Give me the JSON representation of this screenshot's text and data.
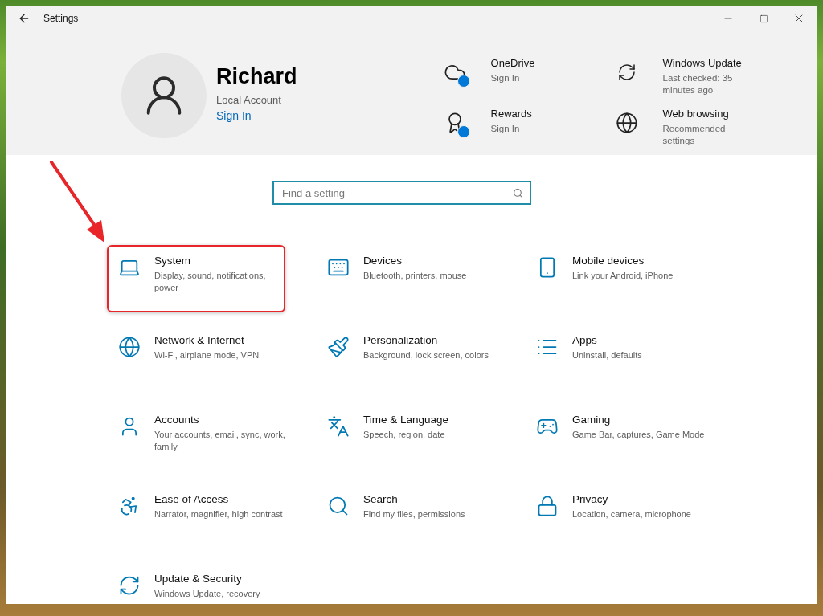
{
  "window": {
    "title": "Settings"
  },
  "account": {
    "name": "Richard",
    "type": "Local Account",
    "link": "Sign In"
  },
  "services": [
    {
      "kind": "cloud",
      "title": "OneDrive",
      "subtitle": "Sign In"
    },
    {
      "kind": "update",
      "title": "Windows Update",
      "subtitle": "Last checked: 35 minutes ago"
    },
    {
      "kind": "rewards",
      "title": "Rewards",
      "subtitle": "Sign In"
    },
    {
      "kind": "globe",
      "title": "Web browsing",
      "subtitle": "Recommended settings"
    }
  ],
  "search": {
    "placeholder": "Find a setting"
  },
  "categories": [
    {
      "kind": "laptop",
      "title": "System",
      "description": "Display, sound, notifications, power",
      "highlighted": true
    },
    {
      "kind": "devices",
      "title": "Devices",
      "description": "Bluetooth, printers, mouse",
      "highlighted": false
    },
    {
      "kind": "phone",
      "title": "Mobile devices",
      "description": "Link your Android, iPhone",
      "highlighted": false
    },
    {
      "kind": "globe",
      "title": "Network & Internet",
      "description": "Wi-Fi, airplane mode, VPN",
      "highlighted": false
    },
    {
      "kind": "paint",
      "title": "Personalization",
      "description": "Background, lock screen, colors",
      "highlighted": false
    },
    {
      "kind": "list",
      "title": "Apps",
      "description": "Uninstall, defaults",
      "highlighted": false
    },
    {
      "kind": "person",
      "title": "Accounts",
      "description": "Your accounts, email, sync, work, family",
      "highlighted": false
    },
    {
      "kind": "language",
      "title": "Time & Language",
      "description": "Speech, region, date",
      "highlighted": false
    },
    {
      "kind": "gamepad",
      "title": "Gaming",
      "description": "Game Bar, captures, Game Mode",
      "highlighted": false
    },
    {
      "kind": "ease",
      "title": "Ease of Access",
      "description": "Narrator, magnifier, high contrast",
      "highlighted": false
    },
    {
      "kind": "search",
      "title": "Search",
      "description": "Find my files, permissions",
      "highlighted": false
    },
    {
      "kind": "lock",
      "title": "Privacy",
      "description": "Location, camera, microphone",
      "highlighted": false
    },
    {
      "kind": "sync",
      "title": "Update & Security",
      "description": "Windows Update, recovery",
      "highlighted": false
    }
  ]
}
